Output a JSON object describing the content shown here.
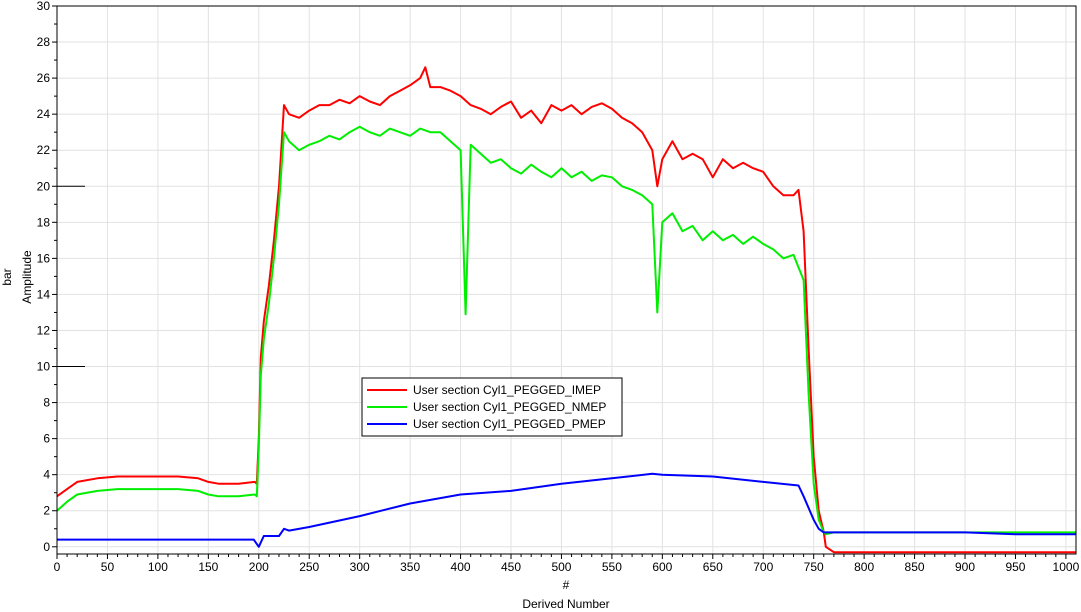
{
  "chart_data": {
    "type": "line",
    "xlabel_symbol": "#",
    "xlabel": "Derived Number",
    "ylabel_unit": "bar",
    "ylabel": "Amplitude",
    "xlim": [
      0,
      1010
    ],
    "ylim": [
      -0.4,
      30
    ],
    "x_ticks": [
      0,
      50,
      100,
      150,
      200,
      250,
      300,
      350,
      400,
      450,
      500,
      550,
      600,
      650,
      700,
      750,
      800,
      850,
      900,
      950,
      1000
    ],
    "y_ticks": [
      0,
      2,
      4,
      6,
      8,
      10,
      12,
      14,
      16,
      18,
      20,
      22,
      24,
      26,
      28,
      30
    ],
    "grid": true,
    "legend_position": "center-left",
    "series": [
      {
        "name": "User section Cyl1_PEGGED_IMEP",
        "color": "#ff0000",
        "x": [
          0,
          10,
          20,
          40,
          60,
          80,
          100,
          120,
          140,
          150,
          160,
          180,
          196,
          198,
          200,
          202,
          205,
          210,
          215,
          220,
          225,
          230,
          240,
          250,
          260,
          270,
          280,
          290,
          300,
          310,
          320,
          330,
          340,
          350,
          360,
          365,
          370,
          380,
          390,
          400,
          410,
          420,
          430,
          440,
          450,
          460,
          470,
          480,
          490,
          500,
          510,
          520,
          530,
          540,
          550,
          560,
          570,
          580,
          590,
          595,
          600,
          610,
          620,
          630,
          640,
          650,
          660,
          670,
          680,
          690,
          700,
          710,
          720,
          730,
          735,
          740,
          745,
          750,
          755,
          760,
          762,
          770,
          800,
          850,
          900,
          950,
          1010
        ],
        "values": [
          2.8,
          3.2,
          3.6,
          3.8,
          3.9,
          3.9,
          3.9,
          3.9,
          3.8,
          3.6,
          3.5,
          3.5,
          3.6,
          3.5,
          6.0,
          10.5,
          12.5,
          14.5,
          17.0,
          20.0,
          24.5,
          24.0,
          23.8,
          24.2,
          24.5,
          24.5,
          24.8,
          24.6,
          25.0,
          24.7,
          24.5,
          25.0,
          25.3,
          25.6,
          26.0,
          26.6,
          25.5,
          25.5,
          25.3,
          25.0,
          24.5,
          24.3,
          24.0,
          24.4,
          24.7,
          23.8,
          24.2,
          23.5,
          24.5,
          24.2,
          24.5,
          24.0,
          24.4,
          24.6,
          24.3,
          23.8,
          23.5,
          23.0,
          22.0,
          20.0,
          21.5,
          22.5,
          21.5,
          21.8,
          21.5,
          20.5,
          21.5,
          21.0,
          21.3,
          21.0,
          20.8,
          20.0,
          19.5,
          19.5,
          19.8,
          17.5,
          11.0,
          5.0,
          2.0,
          0.8,
          0.0,
          -0.3,
          -0.3,
          -0.3,
          -0.3,
          -0.3,
          -0.3
        ]
      },
      {
        "name": "User section Cyl1_PEGGED_NMEP",
        "color": "#00ee00",
        "x": [
          0,
          10,
          20,
          40,
          60,
          80,
          100,
          120,
          140,
          150,
          160,
          180,
          196,
          198,
          200,
          202,
          205,
          210,
          215,
          220,
          225,
          230,
          240,
          250,
          260,
          270,
          280,
          290,
          300,
          310,
          320,
          330,
          340,
          350,
          360,
          370,
          380,
          390,
          400,
          405,
          410,
          420,
          430,
          440,
          450,
          460,
          470,
          480,
          490,
          500,
          510,
          520,
          530,
          540,
          550,
          560,
          570,
          580,
          590,
          595,
          600,
          610,
          620,
          630,
          640,
          650,
          660,
          670,
          680,
          690,
          700,
          710,
          720,
          730,
          735,
          740,
          745,
          750,
          755,
          760,
          762,
          770,
          800,
          850,
          900,
          950,
          1010
        ],
        "values": [
          2.0,
          2.5,
          2.9,
          3.1,
          3.2,
          3.2,
          3.2,
          3.2,
          3.1,
          2.9,
          2.8,
          2.8,
          2.9,
          2.8,
          5.5,
          9.5,
          11.5,
          13.5,
          16.0,
          19.0,
          23.0,
          22.5,
          22.0,
          22.3,
          22.5,
          22.8,
          22.6,
          23.0,
          23.3,
          23.0,
          22.8,
          23.2,
          23.0,
          22.8,
          23.2,
          23.0,
          23.0,
          22.5,
          22.0,
          12.9,
          22.3,
          21.8,
          21.3,
          21.5,
          21.0,
          20.7,
          21.2,
          20.8,
          20.5,
          21.0,
          20.5,
          20.8,
          20.3,
          20.6,
          20.5,
          20.0,
          19.8,
          19.5,
          19.0,
          13.0,
          18.0,
          18.5,
          17.5,
          17.8,
          17.0,
          17.5,
          17.0,
          17.3,
          16.8,
          17.2,
          16.8,
          16.5,
          16.0,
          16.2,
          15.5,
          14.8,
          8.5,
          3.5,
          1.5,
          0.8,
          0.7,
          0.8,
          0.8,
          0.8,
          0.8,
          0.8,
          0.8
        ]
      },
      {
        "name": "User section Cyl1_PEGGED_PMEP",
        "color": "#0000ff",
        "x": [
          0,
          100,
          195,
          200,
          205,
          220,
          225,
          230,
          250,
          300,
          350,
          400,
          450,
          500,
          550,
          590,
          600,
          650,
          700,
          735,
          740,
          750,
          755,
          760,
          770,
          800,
          850,
          900,
          950,
          1010
        ],
        "values": [
          0.4,
          0.4,
          0.4,
          0.0,
          0.6,
          0.6,
          1.0,
          0.9,
          1.1,
          1.7,
          2.4,
          2.9,
          3.1,
          3.5,
          3.8,
          4.05,
          4.0,
          3.9,
          3.6,
          3.4,
          2.8,
          1.5,
          1.0,
          0.8,
          0.8,
          0.8,
          0.8,
          0.8,
          0.7,
          0.7
        ]
      }
    ]
  }
}
